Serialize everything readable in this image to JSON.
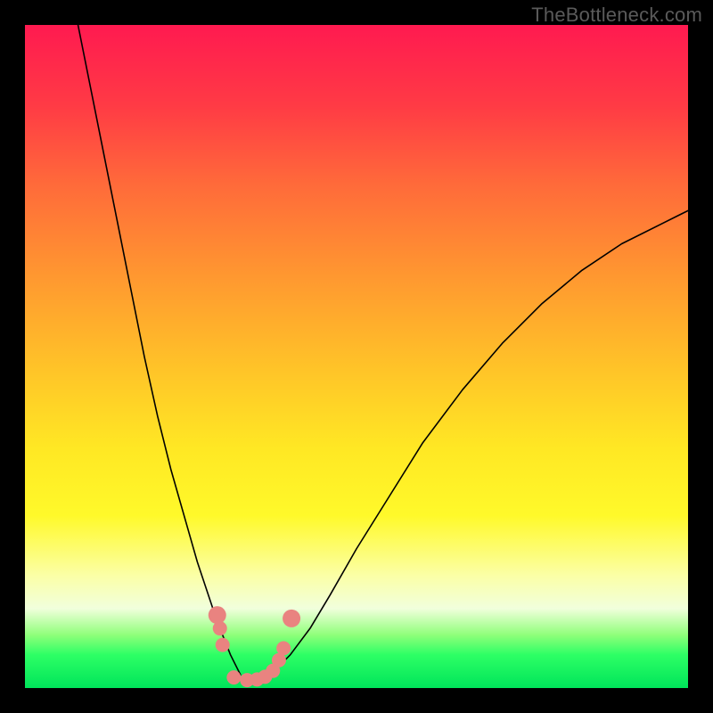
{
  "watermark": "TheBottleneck.com",
  "chart_data": {
    "type": "line",
    "title": "",
    "xlabel": "",
    "ylabel": "",
    "xlim": [
      0,
      100
    ],
    "ylim": [
      0,
      100
    ],
    "grid": false,
    "legend": false,
    "background_gradient": {
      "top": "#ff1a50",
      "bottom": "#00e45a",
      "direction": "vertical"
    },
    "series": [
      {
        "name": "left-arm",
        "stroke": "#000000",
        "x": [
          8,
          10,
          12,
          14,
          16,
          18,
          20,
          22,
          24,
          26,
          28,
          29,
          30,
          31,
          32,
          32.5
        ],
        "values": [
          100,
          90,
          80,
          70,
          60,
          50,
          41,
          33,
          26,
          19,
          13,
          10,
          7.5,
          5,
          3,
          2
        ]
      },
      {
        "name": "right-arm",
        "stroke": "#000000",
        "x": [
          37,
          38,
          40,
          43,
          46,
          50,
          55,
          60,
          66,
          72,
          78,
          84,
          90,
          96,
          100
        ],
        "values": [
          2,
          3,
          5,
          9,
          14,
          21,
          29,
          37,
          45,
          52,
          58,
          63,
          67,
          70,
          72
        ]
      },
      {
        "name": "bottom-ideal-band",
        "stroke": "none",
        "x": [
          0,
          100
        ],
        "values": [
          0,
          2
        ]
      }
    ],
    "markers": {
      "color": "#e98380",
      "radius_primary": 10,
      "radius_secondary": 8,
      "points": [
        {
          "x": 29.0,
          "y": 11.0
        },
        {
          "x": 29.4,
          "y": 9.0
        },
        {
          "x": 29.8,
          "y": 6.5
        },
        {
          "x": 31.5,
          "y": 1.6
        },
        {
          "x": 33.5,
          "y": 1.2
        },
        {
          "x": 35.0,
          "y": 1.3
        },
        {
          "x": 36.2,
          "y": 1.7
        },
        {
          "x": 37.4,
          "y": 2.6
        },
        {
          "x": 38.3,
          "y": 4.2
        },
        {
          "x": 39.0,
          "y": 6.0
        },
        {
          "x": 40.2,
          "y": 10.5
        }
      ]
    }
  }
}
